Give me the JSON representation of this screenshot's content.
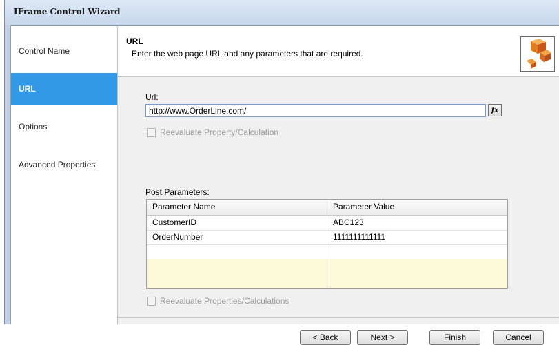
{
  "window": {
    "title": "IFrame Control Wizard"
  },
  "sidebar": {
    "items": [
      {
        "label": "Control Name"
      },
      {
        "label": "URL"
      },
      {
        "label": "Options"
      },
      {
        "label": "Advanced Properties"
      }
    ],
    "active_index": 1
  },
  "header": {
    "title": "URL",
    "subtitle": "Enter the web page URL and any parameters that are required.",
    "icon": "boxes-icon"
  },
  "url_section": {
    "label": "Url:",
    "value": "http://www.OrderLine.com/",
    "fx_label": "fx",
    "reevaluate_label": "Reevaluate Property/Calculation"
  },
  "params": {
    "label": "Post Parameters:",
    "columns": [
      "Parameter Name",
      "Parameter Value"
    ],
    "rows": [
      [
        "CustomerID",
        "ABC123"
      ],
      [
        "OrderNumber",
        "1111111111111"
      ]
    ],
    "reevaluate_label": "Reevaluate Properties/Calculations"
  },
  "footer": {
    "back_label": "< Back",
    "next_label": "Next >",
    "finish_label": "Finish",
    "cancel_label": "Cancel"
  },
  "colors": {
    "accent": "#3399e6",
    "grid_new_row": "#fcf9d9"
  }
}
